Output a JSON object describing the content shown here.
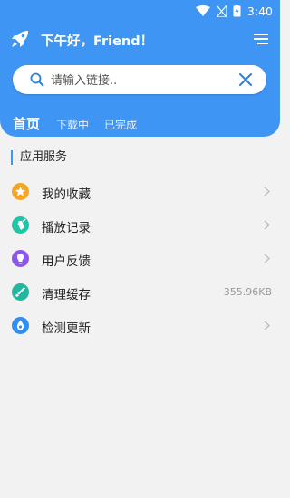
{
  "status_bar": {
    "time": "3:40",
    "icons": [
      "wifi-icon",
      "no-signal-icon",
      "battery-charging-icon"
    ]
  },
  "header": {
    "greeting": "下午好，Friend！",
    "logo_icon": "rocket-icon",
    "menu_icon": "menu-icon"
  },
  "search": {
    "placeholder": "请输入链接..",
    "value": "",
    "icon": "search-icon",
    "clear_icon": "close-icon"
  },
  "tabs": [
    {
      "label": "首页",
      "active": true
    },
    {
      "label": "下载中",
      "active": false
    },
    {
      "label": "已完成",
      "active": false
    }
  ],
  "section": {
    "title": "应用服务"
  },
  "services": [
    {
      "label": "我的收藏",
      "icon": "star-icon",
      "color": "#f5a623",
      "trailing": "chevron"
    },
    {
      "label": "播放记录",
      "icon": "history-icon",
      "color": "#1ec6a5",
      "trailing": "chevron"
    },
    {
      "label": "用户反馈",
      "icon": "feedback-icon",
      "color": "#8e55ea",
      "trailing": "chevron"
    },
    {
      "label": "清理缓存",
      "icon": "clean-icon",
      "color": "#22b7a0",
      "trailing": "value",
      "value": "355.96KB"
    },
    {
      "label": "检测更新",
      "icon": "update-icon",
      "color": "#2f8ef2",
      "trailing": "chevron"
    }
  ],
  "colors": {
    "primary": "#3f95f3",
    "background": "#f2f2f2"
  }
}
